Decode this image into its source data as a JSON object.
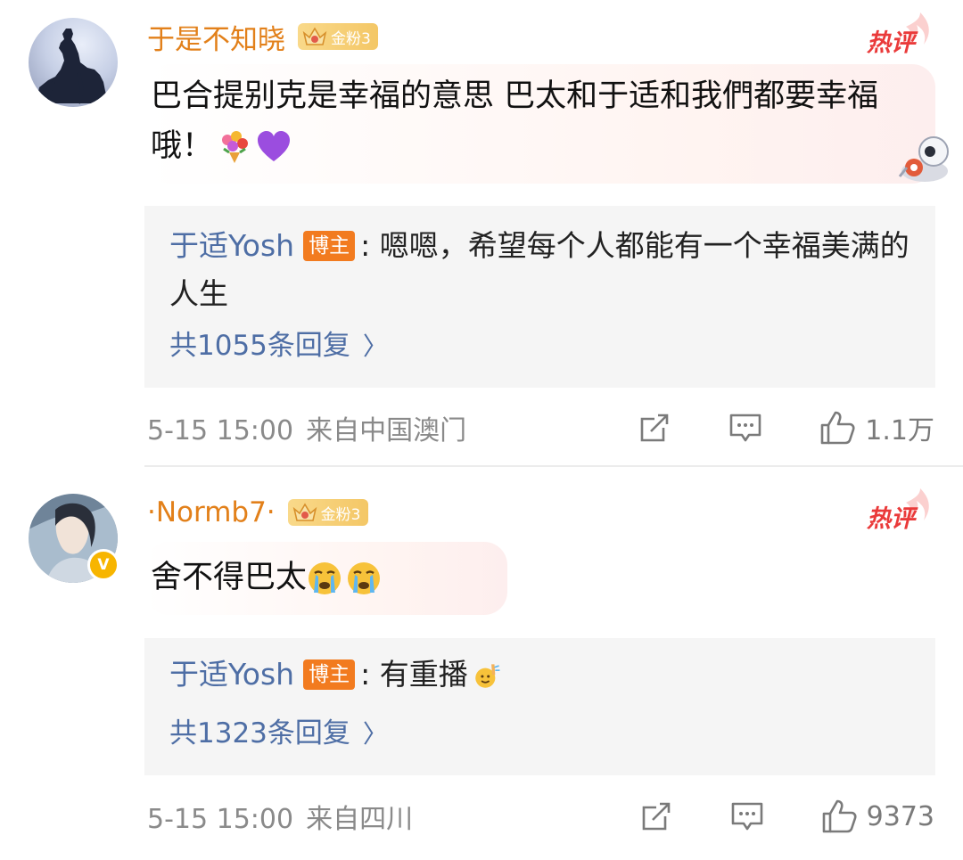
{
  "comments": [
    {
      "username": "于是不知晓",
      "fan_badge": "金粉3",
      "hot_label": "热评",
      "text": "巴合提别克是幸福的意思 巴太和于适和我們都要幸福哦！",
      "reply": {
        "author": "于适Yosh",
        "author_badge": "博主",
        "separator": ":",
        "text": "嗯嗯，希望每个人都能有一个幸福美满的人生",
        "count_label": "共1055条回复",
        "chevron": "〉"
      },
      "meta": {
        "date": "5-15 15:00",
        "location": "来自中国澳门",
        "likes": "1.1万"
      }
    },
    {
      "username": "·Normb7·",
      "fan_badge": "金粉3",
      "hot_label": "热评",
      "text": "舍不得巴太",
      "reply": {
        "author": "于适Yosh",
        "author_badge": "博主",
        "separator": ":",
        "text": "有重播",
        "count_label": "共1323条回复",
        "chevron": "〉"
      },
      "meta": {
        "date": "5-15 15:00",
        "location": "来自四川",
        "likes": "9373"
      }
    }
  ],
  "icons": {
    "emoji_c1": [
      "bouquet-emoji",
      "purple-heart-emoji"
    ],
    "emoji_c2": [
      "crying-face-emoji",
      "crying-face-emoji"
    ],
    "emoji_reply_c2": "waving-hand-emoji",
    "actions": [
      "share-icon",
      "comment-icon",
      "like-icon"
    ]
  },
  "colors": {
    "username": "#e2801a",
    "reply_author": "#4e6ea5",
    "author_badge": "#f27b1f",
    "hot_label": "#ea3a3a",
    "fan_badge": "#f4c766",
    "meta": "#8a8a8a"
  }
}
